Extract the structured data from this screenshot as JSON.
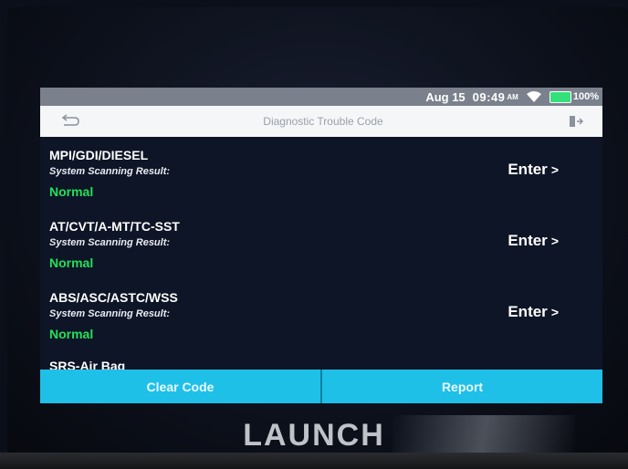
{
  "status_bar": {
    "date": "Aug 15",
    "time": "09:49",
    "ampm": "AM",
    "battery": "100%"
  },
  "nav": {
    "title": "Diagnostic Trouble Code"
  },
  "systems": [
    {
      "name": "MPI/GDI/DIESEL",
      "label": "System Scanning Result:",
      "status": "Normal",
      "enter": "Enter",
      "arrow": ">"
    },
    {
      "name": "AT/CVT/A-MT/TC-SST",
      "label": "System Scanning Result:",
      "status": "Normal",
      "enter": "Enter",
      "arrow": ">"
    },
    {
      "name": "ABS/ASC/ASTC/WSS",
      "label": "System Scanning Result:",
      "status": "Normal",
      "enter": "Enter",
      "arrow": ">"
    }
  ],
  "partial_item": {
    "name": "SRS-Air Bag"
  },
  "footer": {
    "clear_code": "Clear Code",
    "report": "Report"
  },
  "brand": "LAUNCH",
  "colors": {
    "status_normal": "#22e05a",
    "button_bg": "#1fc0e8",
    "screen_bg": "#0e1526",
    "statusbar_bg": "#7a818d"
  }
}
